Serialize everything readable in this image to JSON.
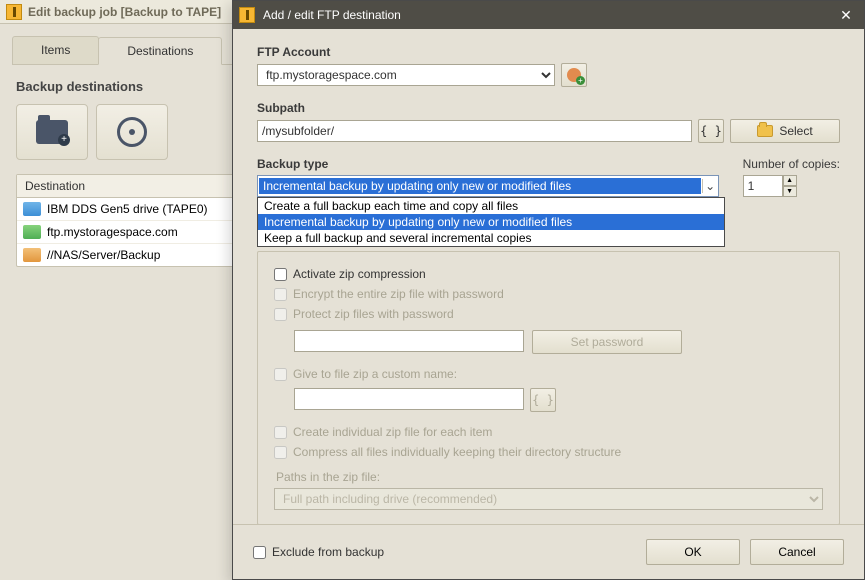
{
  "bg": {
    "title": "Edit backup job    [Backup to TAPE]",
    "tabs": {
      "items": "Items",
      "destinations": "Destinations"
    },
    "panel_title": "Backup destinations",
    "list_header": "Destination",
    "rows": [
      {
        "label": "IBM DDS Gen5 drive (TAPE0)"
      },
      {
        "label": "ftp.mystoragespace.com"
      },
      {
        "label": "//NAS/Server/Backup"
      }
    ]
  },
  "modal": {
    "title": "Add / edit FTP destination",
    "ftp_account_label": "FTP Account",
    "ftp_account_value": "ftp.mystoragespace.com",
    "subpath_label": "Subpath",
    "subpath_value": "/mysubfolder/",
    "select_btn": "Select",
    "backup_type_label": "Backup type",
    "backup_type_selected": "Incremental backup by updating only new or modified files",
    "backup_type_options": [
      "Create a full backup each time and copy all files",
      "Incremental backup by updating only new or modified files",
      "Keep a full backup and several incremental copies"
    ],
    "copies_label": "Number of copies:",
    "copies_value": "1",
    "zip": {
      "activate": "Activate zip compression",
      "encrypt": "Encrypt the entire zip file with password",
      "protect": "Protect zip files with password",
      "set_password": "Set password",
      "custom_name": "Give to file zip a custom name:",
      "individual": "Create individual zip file for each item",
      "compress_all": "Compress all files individually keeping their directory structure",
      "paths_label": "Paths in the zip file:",
      "paths_value": "Full path including drive (recommended)"
    },
    "exclude": "Exclude from backup",
    "ok": "OK",
    "cancel": "Cancel"
  }
}
